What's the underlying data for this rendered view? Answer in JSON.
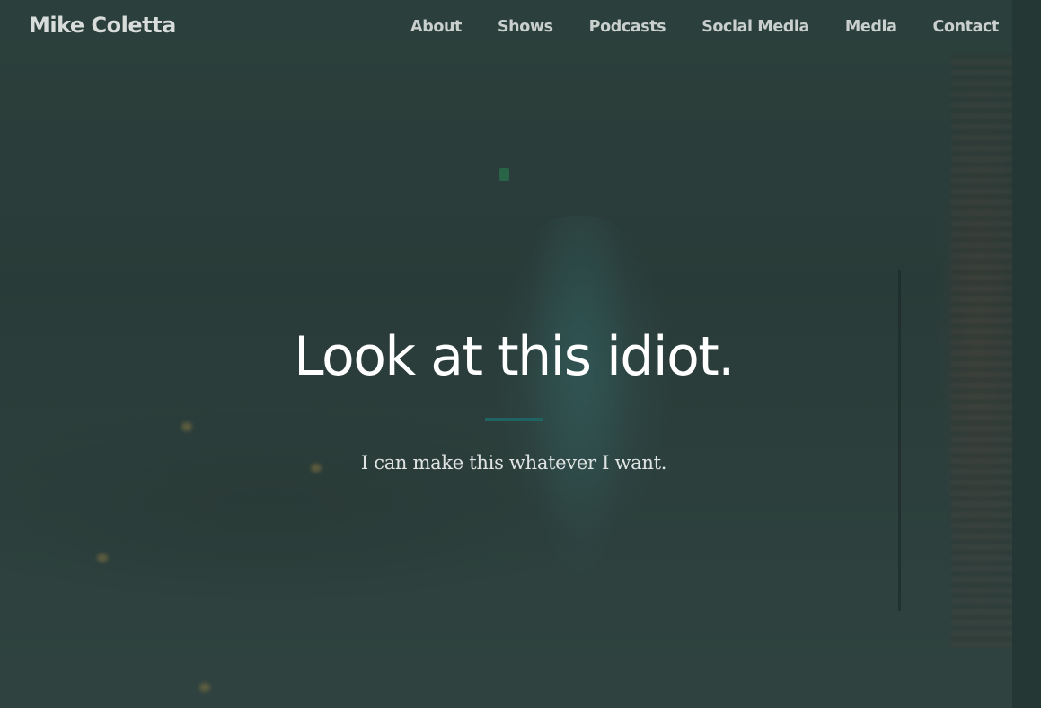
{
  "header": {
    "brand": "Mike Coletta",
    "nav": [
      {
        "label": "About"
      },
      {
        "label": "Shows"
      },
      {
        "label": "Podcasts"
      },
      {
        "label": "Social Media"
      },
      {
        "label": "Media"
      },
      {
        "label": "Contact"
      }
    ]
  },
  "hero": {
    "title": "Look at this idiot.",
    "subtitle": "I can make this whatever I want.",
    "background_image": "comedian-on-stage-photo"
  },
  "colors": {
    "overlay": "#2e403d",
    "divider": "#1f6462",
    "title_text": "#ffffff",
    "nav_text": "#c9cfcd"
  }
}
